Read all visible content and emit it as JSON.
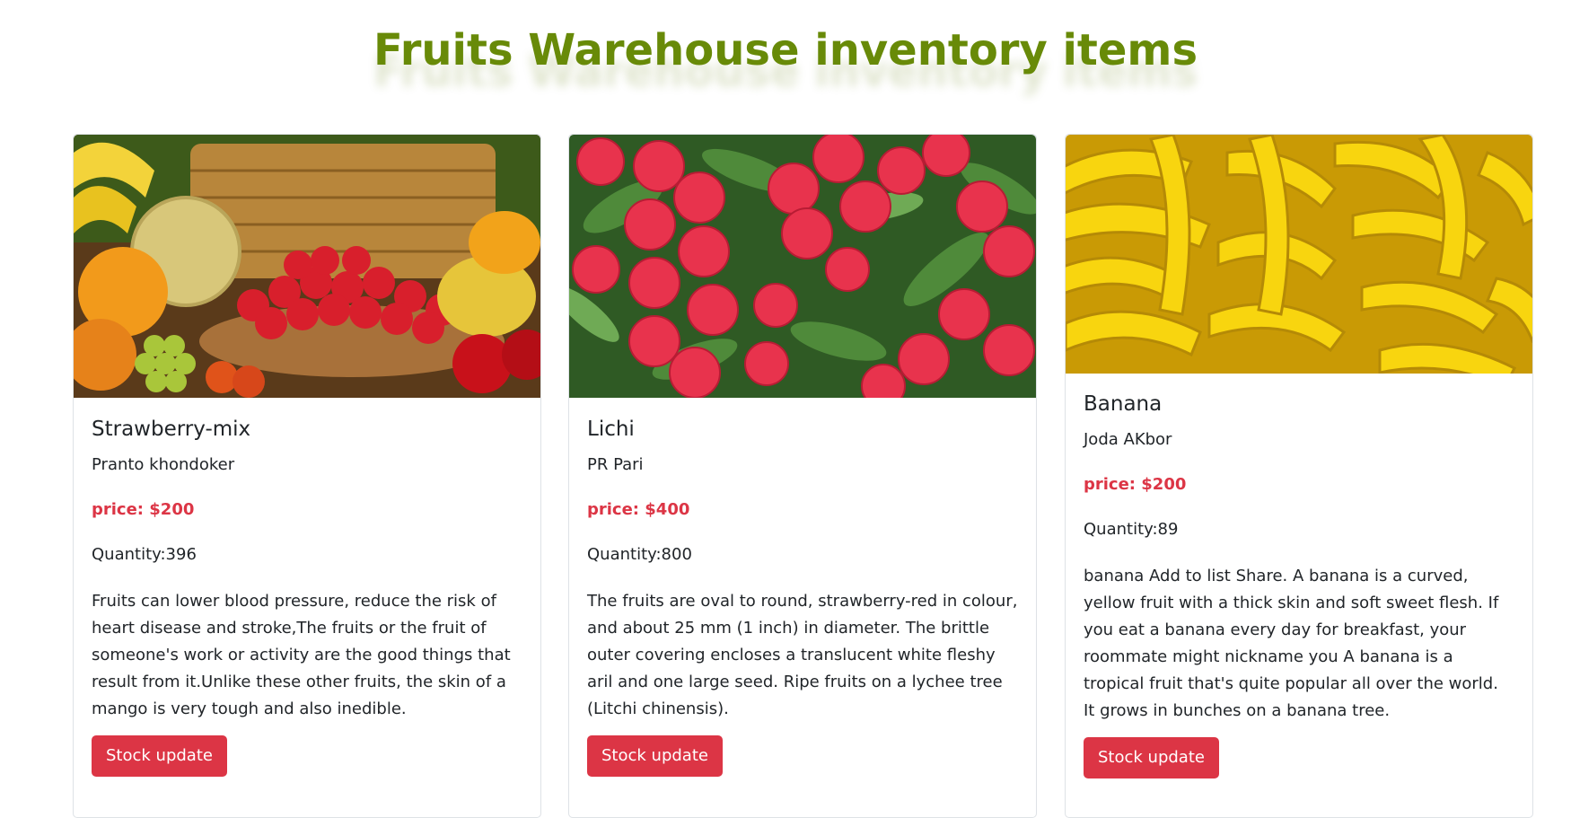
{
  "page": {
    "title": "Fruits Warehouse inventory items"
  },
  "colors": {
    "title_green": "#688a08",
    "button_red": "#dc3545",
    "price_red": "#dc3545"
  },
  "items": [
    {
      "name": "Strawberry-mix",
      "supplier": "Pranto khondoker",
      "price": "price: $200",
      "quantity": "Quantity:396",
      "description": "Fruits can lower blood pressure, reduce the risk of heart disease and stroke,The fruits or the fruit of someone's work or activity are the good things that result from it.Unlike these other fruits, the skin of a mango is very tough and also inedible.",
      "button_label": "Stock update",
      "image": "fruit-basket-image"
    },
    {
      "name": "Lichi",
      "supplier": "PR Pari",
      "price": "price: $400",
      "quantity": "Quantity:800",
      "description": "The fruits are oval to round, strawberry-red in colour, and about 25 mm (1 inch) in diameter. The brittle outer covering encloses a translucent white fleshy aril and one large seed. Ripe fruits on a lychee tree (Litchi chinensis).",
      "button_label": "Stock update",
      "image": "lychee-image"
    },
    {
      "name": "Banana",
      "supplier": "Joda AKbor",
      "price": "price: $200",
      "quantity": "Quantity:89",
      "description": "banana Add to list Share. A banana is a curved, yellow fruit with a thick skin and soft sweet flesh. If you eat a banana every day for breakfast, your roommate might nickname you A banana is a tropical fruit that's quite popular all over the world. It grows in bunches on a banana tree.",
      "button_label": "Stock update",
      "image": "bananas-image"
    }
  ]
}
